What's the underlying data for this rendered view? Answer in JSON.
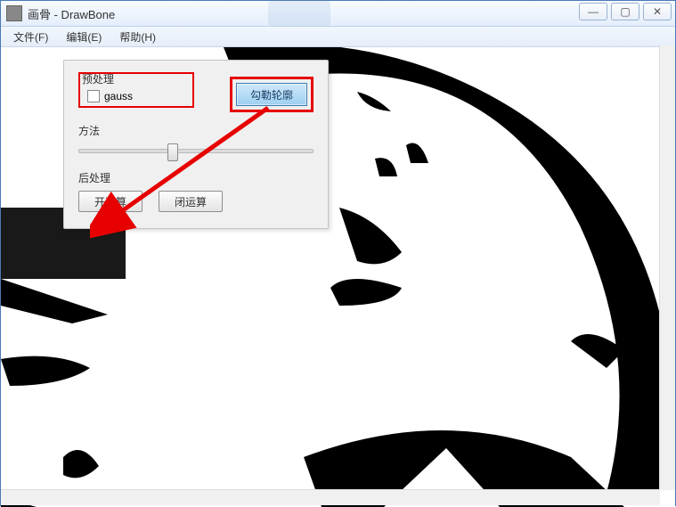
{
  "window": {
    "title": "画骨 - DrawBone"
  },
  "menu": {
    "file": "文件(F)",
    "edit": "编辑(E)",
    "help": "帮助(H)"
  },
  "panel": {
    "preprocess_label": "预处理",
    "gauss_label": "gauss",
    "outline_button": "勾勒轮廓",
    "method_label": "方法",
    "postprocess_label": "后处理",
    "open_op": "开运算",
    "close_op": "闭运算"
  },
  "window_controls": {
    "min": "—",
    "max": "▢",
    "close": "✕"
  }
}
